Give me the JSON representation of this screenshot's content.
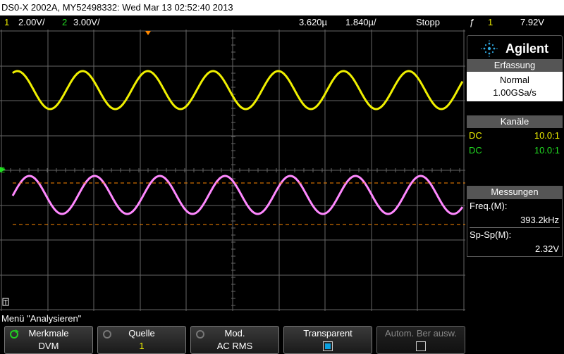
{
  "title": "DS0-X 2002A, MY52498332: Wed Mar 13 02:52:40 2013",
  "status": {
    "ch1_num": "1",
    "ch1_scale": "2.00V/",
    "ch2_num": "2",
    "ch2_scale": "3.00V/",
    "time_pos": "3.620µ",
    "time_scale": "1.840µ/",
    "run_state": "Stopp",
    "trigger_icon": "ƒ",
    "trigger_ch": "1",
    "trigger_level": "7.92V"
  },
  "panel": {
    "brand": "Agilent",
    "acq_title": "Erfassung",
    "acq_mode": "Normal",
    "acq_rate": "1.00GSa/s",
    "ch_title": "Kanäle",
    "ch1_coupling": "DC",
    "ch1_probe": "10.0:1",
    "ch2_coupling": "DC",
    "ch2_probe": "10.0:1",
    "meas_title": "Messungen",
    "meas1_label": "Freq.(M):",
    "meas1_value": "393.2kHz",
    "meas2_label": "Sp-Sp(M):",
    "meas2_value": "2.32V"
  },
  "menu_label": "Menü \"Analysieren\"",
  "softkeys": [
    {
      "label": "Merkmale",
      "value": "DVM"
    },
    {
      "label": "Quelle",
      "value": "1"
    },
    {
      "label": "Mod.",
      "value": "AC RMS"
    },
    {
      "label": "Transparent",
      "checked": true
    },
    {
      "label": "Autom. Ber ausw.",
      "checked": false
    }
  ],
  "markers": {
    "ch2_ground": "2",
    "ch1_tick": "T"
  },
  "colors": {
    "ch1": "#f0f000",
    "ch2": "#ff88ff",
    "ch2_label": "#22dd22",
    "grid": "#666666",
    "cursor": "#ff8800",
    "accent": "#0aa0e0"
  }
}
